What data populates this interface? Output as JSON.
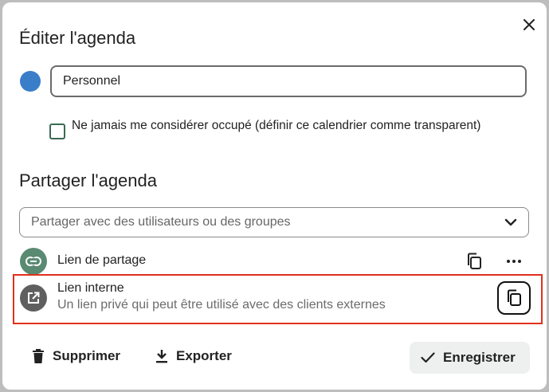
{
  "dialog": {
    "title": "Éditer l'agenda",
    "close_icon": "close-icon"
  },
  "calendar": {
    "color": "#3a7dc9",
    "name_value": "Personnel",
    "transparent_label": "Ne jamais me considérer occupé (définir ce calendrier comme transparent)",
    "transparent_checked": false
  },
  "sharing": {
    "title": "Partager l'agenda",
    "select_placeholder": "Partager avec des utilisateurs ou des groupes",
    "share_link": {
      "label": "Lien de partage",
      "icon": "link-icon",
      "icon_bg": "#5a8a72"
    },
    "internal_link": {
      "label": "Lien interne",
      "description": "Un lien privé qui peut être utilisé avec des clients externes",
      "icon": "external-link-icon",
      "icon_bg": "#5f5f5f"
    },
    "highlight_color": "#e0311b"
  },
  "footer": {
    "delete_label": "Supprimer",
    "export_label": "Exporter",
    "save_label": "Enregistrer",
    "save_bg": "#eef0f0"
  }
}
